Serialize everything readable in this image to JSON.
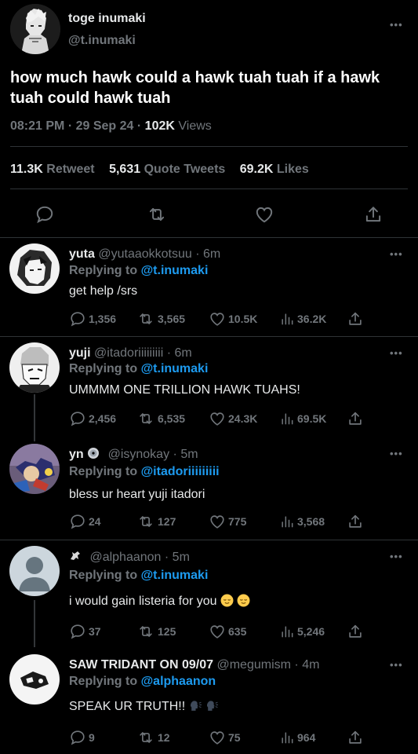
{
  "colors": {
    "background": "#000000",
    "text": "#e7e9ea",
    "muted": "#71767b",
    "link": "#1d9bf0",
    "divider": "#2f3336"
  },
  "main_tweet": {
    "display_name": "toge inumaki",
    "handle": "@t.inumaki",
    "more_icon": "more-horizontal-icon",
    "text": "how much hawk could a hawk tuah tuah if a hawk tuah could hawk tuah",
    "time": "08:21 PM",
    "date": "29 Sep 24",
    "separator": "·",
    "views_count": "102K",
    "views_label": "Views",
    "retweets_count": "11.3K",
    "retweets_label": "Retweet",
    "quotes_count": "5,631",
    "quotes_label": "Quote Tweets",
    "likes_count": "69.2K",
    "likes_label": "Likes",
    "actions": [
      "reply-icon",
      "retweet-icon",
      "like-icon",
      "share-icon"
    ]
  },
  "replies": [
    {
      "display_name": "yuta",
      "handle": "@yutaaokkotsuu",
      "time": "6m",
      "replying_label": "Replying to",
      "replying_to": "@t.inumaki",
      "text": "get help /srs",
      "replies": "1,356",
      "retweets": "3,565",
      "likes": "10.5K",
      "views": "36.2K"
    },
    {
      "display_name": "yuji",
      "handle": "@itadoriiiiiiiii",
      "time": "6m",
      "replying_label": "Replying to",
      "replying_to": "@t.inumaki",
      "text": "UMMMM ONE TRILLION HAWK TUAHS!",
      "replies": "2,456",
      "retweets": "6,535",
      "likes": "24.3K",
      "views": "69.5K"
    },
    {
      "display_name": "yn",
      "name_emoji": "disc-emoji",
      "handle": "@isynokay",
      "time": "5m",
      "replying_label": "Replying to",
      "replying_to": "@itadoriiiiiiiii",
      "text": "bless ur heart yuji itadori",
      "replies": "24",
      "retweets": "127",
      "likes": "775",
      "views": "3,568"
    },
    {
      "display_name": "",
      "name_emoji": "pegasus-emoji",
      "handle": "@alphaanon",
      "time": "5m",
      "replying_label": "Replying to",
      "replying_to": "@t.inumaki",
      "text": "i would gain listeria for you",
      "text_emojis": [
        "relieved-face-emoji",
        "relieved-face-emoji"
      ],
      "replies": "37",
      "retweets": "125",
      "likes": "635",
      "views": "5,246"
    },
    {
      "display_name": "SAW TRIDANT ON 09/07",
      "handle": "@megumism",
      "time": "4m",
      "replying_label": "Replying to",
      "replying_to": "@alphaanon",
      "text": "SPEAK UR TRUTH!!",
      "text_emojis": [
        "speaking-head-emoji",
        "speaking-head-emoji"
      ],
      "replies": "9",
      "retweets": "12",
      "likes": "75",
      "views": "964"
    }
  ]
}
